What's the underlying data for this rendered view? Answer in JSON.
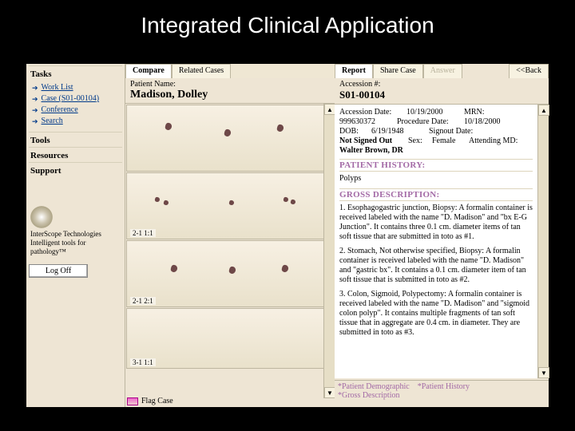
{
  "slide_title": "Integrated Clinical Application",
  "sidebar": {
    "sections": {
      "tasks": "Tasks",
      "tools": "Tools",
      "resources": "Resources",
      "support": "Support"
    },
    "items": {
      "work_list": "Work List",
      "case": "Case (S01-00104)",
      "conference": "Conference",
      "search": "Search"
    },
    "logo_line1": "InterScope Technologies",
    "logo_line2": "Intelligent tools for pathology™",
    "logoff": "Log Off"
  },
  "main_tabs": {
    "compare": "Compare",
    "related": "Related Cases",
    "report": "Report",
    "share": "Share Case",
    "answer": "Answer",
    "back": "<<Back"
  },
  "patient": {
    "label_name": "Patient Name:",
    "name": "Madison, Dolley",
    "label_acc": "Accession #:",
    "accession": "S01-00104"
  },
  "thumbs": [
    "2-1 1:1",
    "2-1 2:1",
    "3-1 1:1"
  ],
  "flag_case": "Flag Case",
  "report": {
    "fields": {
      "accession_date_k": "Accession Date:",
      "accession_date_v": "10/19/2000",
      "mrn_k": "MRN:",
      "mrn_v": "999630372",
      "procedure_date_k": "Procedure Date:",
      "procedure_date_v": "10/18/2000",
      "dob_k": "DOB:",
      "dob_v": "6/19/1948",
      "signout_date_k": "Signout Date:",
      "signout_date_v": "Not Signed Out",
      "sex_k": "Sex:",
      "sex_v": "Female",
      "attending_k": "Attending MD:",
      "attending_v": "Walter Brown, DR"
    },
    "hist_hdr": "PATIENT HISTORY:",
    "hist_body": "Polyps",
    "gross_hdr": "GROSS DESCRIPTION:",
    "gross_p1": "1. Esophagogastric junction, Biopsy: A formalin container is received labeled with the name \"D. Madison\" and \"bx E-G Junction\". It contains three 0.1 cm. diameter items of tan soft tissue that are submitted in toto as #1.",
    "gross_p2": "2. Stomach, Not otherwise specified, Biopsy: A formalin container is received labeled with the name \"D. Madison\" and \"gastric bx\". It contains a 0.1 cm. diameter item of tan soft tissue that is submitted in toto as #2.",
    "gross_p3": "3. Colon, Sigmoid, Polypectomy: A formalin container is received labeled with the name \"D. Madison\" and \"sigmoid colon polyp\". It contains multiple fragments of tan soft tissue that in aggregate are 0.4 cm. in diameter. They are submitted in toto as #3."
  },
  "report_tabs": {
    "demo": "*Patient Demographic",
    "hist": "*Patient History",
    "gross": "*Gross Description"
  }
}
